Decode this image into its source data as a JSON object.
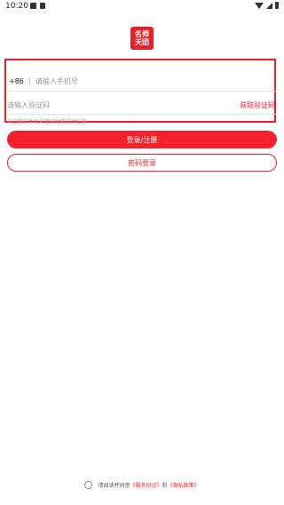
{
  "status_bar": {
    "time": "10:20"
  },
  "logo": {
    "line1": "名师",
    "line2": "天团"
  },
  "login_form": {
    "country_code": "+86",
    "phone_placeholder": "请输入手机号",
    "code_placeholder": "请输入验证码",
    "get_code_label": "获取验证码",
    "hint": "未注册的手机号登录时将自动注册"
  },
  "buttons": {
    "login_register": "登录/注册",
    "password_login": "密码登录"
  },
  "agreement": {
    "prefix": "请阅读并同意",
    "service_link": "《服务协议》",
    "and": "和",
    "privacy_link": "《隐私政策》"
  },
  "colors": {
    "accent": "#e8202a"
  }
}
